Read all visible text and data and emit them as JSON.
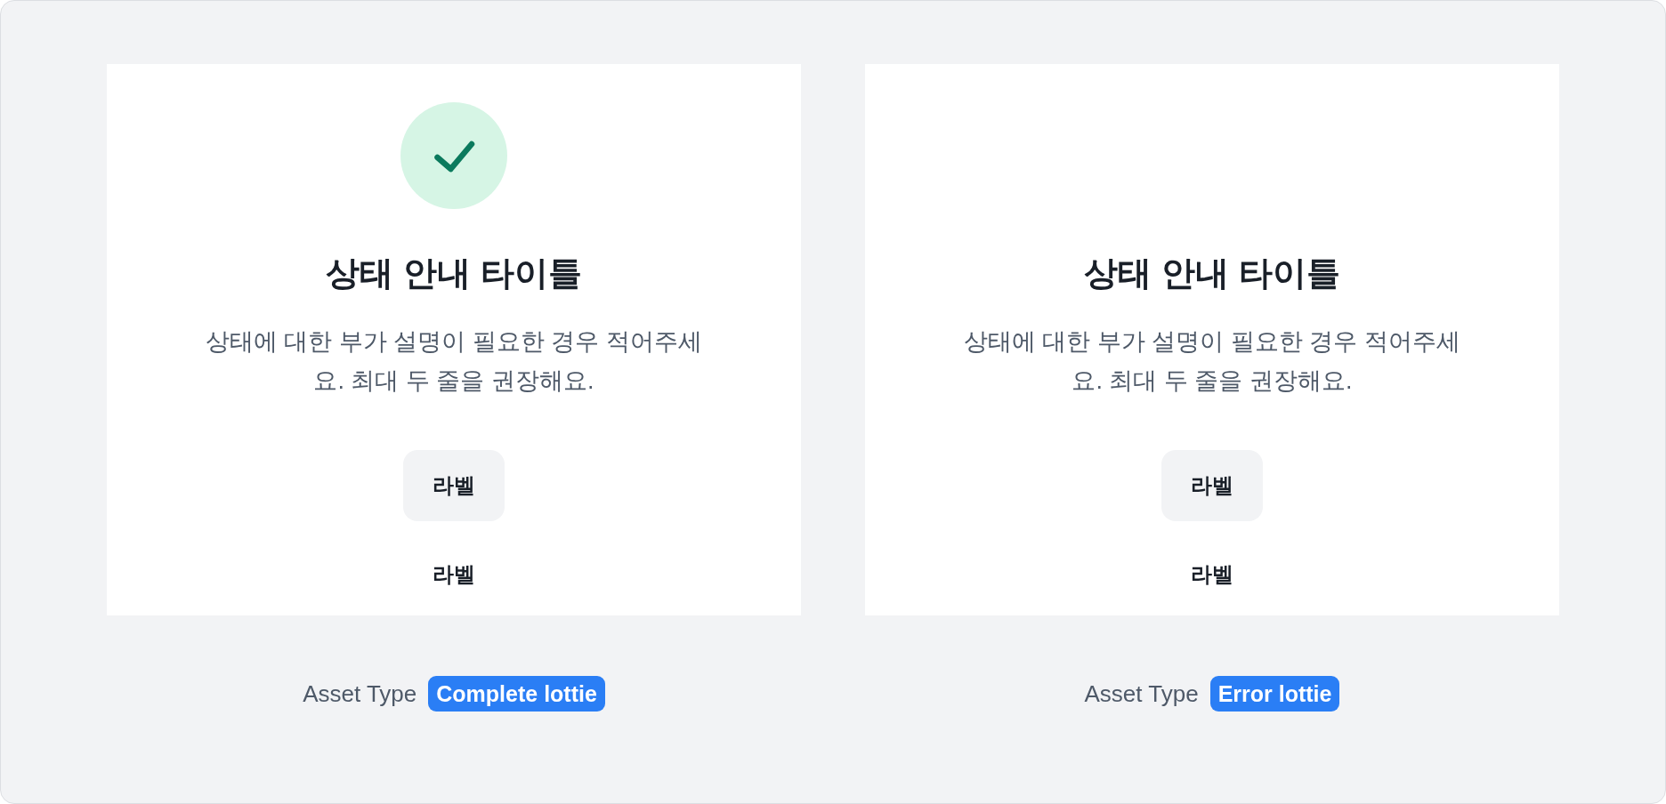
{
  "cards": [
    {
      "kind": "check",
      "title": "상태 안내 타이틀",
      "description": "상태에 대한 부가 설명이 필요한 경우 적어주세요. 최대 두 줄을 권장해요.",
      "primary_button": "라벨",
      "text_button": "라벨",
      "asset_type": {
        "label": "Asset Type",
        "value": "Complete lottie"
      }
    },
    {
      "kind": "blank",
      "title": "상태 안내 타이틀",
      "description": "상태에 대한 부가 설명이 필요한 경우 적어주세요. 최대 두 줄을 권장해요.",
      "primary_button": "라벨",
      "text_button": "라벨",
      "asset_type": {
        "label": "Asset Type",
        "value": "Error lottie"
      }
    }
  ]
}
